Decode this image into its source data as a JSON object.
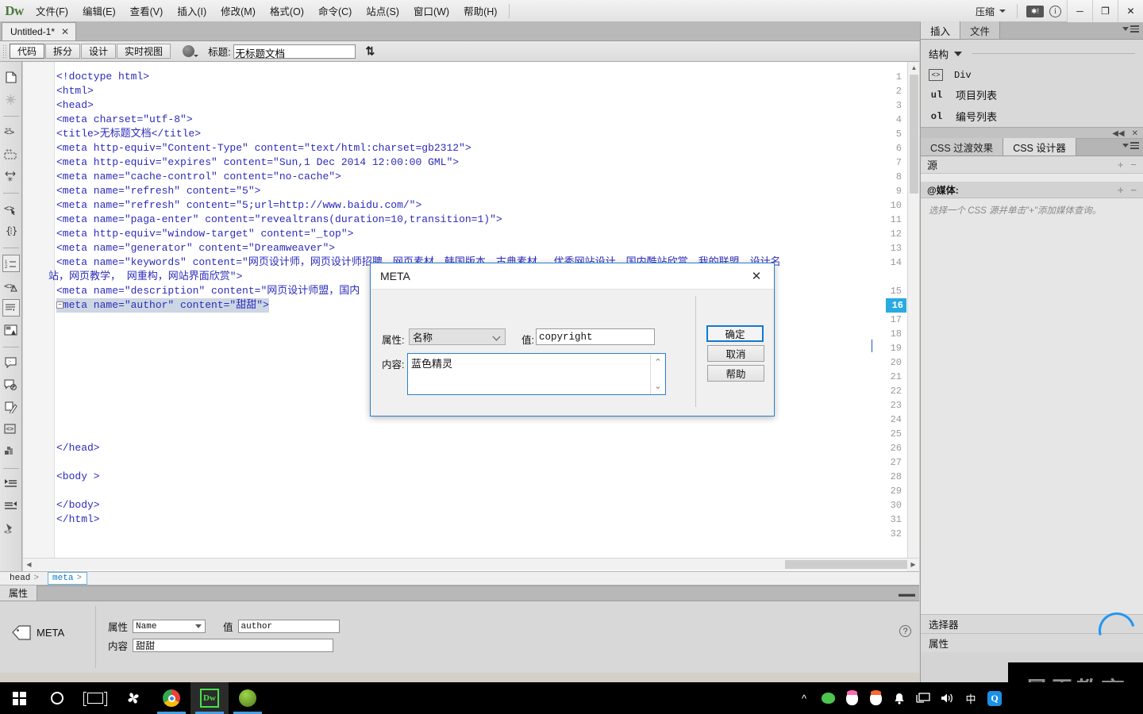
{
  "app": {
    "logo": "Dw",
    "menus": [
      "文件(F)",
      "编辑(E)",
      "查看(V)",
      "插入(I)",
      "修改(M)",
      "格式(O)",
      "命令(C)",
      "站点(S)",
      "窗口(W)",
      "帮助(H)"
    ],
    "workspace_label": "压缩",
    "badge": "✱!",
    "info": "i",
    "window_buttons": {
      "minimize": "─",
      "maximize": "❐",
      "close": "✕"
    }
  },
  "doc_tab": {
    "name": "Untitled-1*",
    "close": "✕"
  },
  "viewbar": {
    "buttons": [
      "代码",
      "拆分",
      "设计",
      "实时视图"
    ],
    "active_button": "代码",
    "title_label": "标题:",
    "title_value": "无标题文档",
    "swap_icon": "⇅"
  },
  "left_toolbar": {
    "icons": [
      "open-documents-icon",
      "highlight-invalid-icon",
      "apply-comment-icon",
      "remove-comment-icon",
      "wrap-tag-icon",
      "select-parent-tag-icon",
      "balance-braces-icon",
      "line-numbers-icon",
      "highlight-invalid-code-icon",
      "word-wrap-icon",
      "syntax-color-icon",
      "recent-snippets-icon",
      "collapse-selection-icon",
      "expand-all-icon",
      "format-source-icon",
      "indent-code-icon",
      "outdent-code-icon",
      "outdent-line-icon",
      "apply-source-format-icon"
    ]
  },
  "code": {
    "lines": [
      {
        "n": 1,
        "text": "<!doctype html>"
      },
      {
        "n": 2,
        "text": "<html>"
      },
      {
        "n": 3,
        "text": "<head>"
      },
      {
        "n": 4,
        "text": "<meta charset=\"utf-8\">"
      },
      {
        "n": 5,
        "text": "<title>无标题文档</title>"
      },
      {
        "n": 6,
        "text": "<meta http-equiv=\"Content-Type\" content=\"text/html:charset=gb2312\">"
      },
      {
        "n": 7,
        "text": "<meta http-equiv=\"expires\" content=\"Sun,1 Dec 2014 12:00:00 GML\">"
      },
      {
        "n": 8,
        "text": "<meta name=\"cache-control\" content=\"no-cache\">"
      },
      {
        "n": 9,
        "text": "<meta name=\"refresh\" content=\"5\">"
      },
      {
        "n": 10,
        "text": "<meta name=\"refresh\" content=\"5;url=http://www.baidu.com/\">"
      },
      {
        "n": 11,
        "text": "<meta name=\"paga-enter\" content=\"revealtrans(duration=10,transition=1)\">"
      },
      {
        "n": 12,
        "text": "<meta http-equiv=\"window-target\" content=\"_top\">"
      },
      {
        "n": 13,
        "text": "<meta name=\"generator\" content=\"Dreamweaver\">"
      },
      {
        "n": 14,
        "text": "<meta name=\"keywords\" content=\"网页设计师，网页设计师招聘，网页素材，韩国版本，古典素材， 优秀网站设计，国内酷站欣赏，我的联盟，设计名"
      },
      {
        "n": 14,
        "text": "站，网页教学， 网重构，网站界面欣赏\">",
        "wrapped": true
      },
      {
        "n": 15,
        "text": "<meta name=\"description\" content=\"网页设计师盟，国内"
      },
      {
        "n": 16,
        "text": "<meta name=\"author\" content=\"甜甜\">",
        "selected": true,
        "foldable": true
      },
      {
        "n": 17,
        "text": ""
      },
      {
        "n": 18,
        "text": ""
      },
      {
        "n": 19,
        "text": ""
      },
      {
        "n": 20,
        "text": ""
      },
      {
        "n": 21,
        "text": ""
      },
      {
        "n": 22,
        "text": ""
      },
      {
        "n": 23,
        "text": ""
      },
      {
        "n": 24,
        "text": ""
      },
      {
        "n": 25,
        "text": ""
      },
      {
        "n": 26,
        "text": "</head>"
      },
      {
        "n": 27,
        "text": ""
      },
      {
        "n": 28,
        "text": "<body >"
      },
      {
        "n": 29,
        "text": ""
      },
      {
        "n": 30,
        "text": "</body>"
      },
      {
        "n": 31,
        "text": "</html>"
      },
      {
        "n": 32,
        "text": ""
      }
    ]
  },
  "tag_selector": {
    "tags": [
      "head",
      "meta"
    ],
    "active": "meta"
  },
  "properties": {
    "tab_label": "属性",
    "element": "META",
    "attribute_label": "属性",
    "attribute_value": "Name",
    "value_label": "值",
    "value_value": "author",
    "content_label": "内容",
    "content_value": "甜甜",
    "help": "?"
  },
  "right_dock": {
    "top_tabs": [
      "插入",
      "文件"
    ],
    "top_active": "插入",
    "structure_label": "结构",
    "insert_items": [
      {
        "icon": "<>",
        "label": "Div",
        "mono": true
      },
      {
        "icon": "ul",
        "label": "项目列表",
        "mono": false
      },
      {
        "icon": "ol",
        "label": "编号列表",
        "mono": false
      }
    ],
    "collapse_icons": [
      "◀◀",
      "✕"
    ],
    "css_tabs": [
      "CSS 过渡效果",
      "CSS 设计器"
    ],
    "css_active": "CSS 设计器",
    "source_label": "源",
    "source_buttons": [
      "+",
      "−"
    ],
    "media_label": "@媒体:",
    "media_buttons": [
      "+",
      "−"
    ],
    "media_hint": "选择一个 CSS 源并单击\"+\"添加媒体查询。",
    "selector_label": "选择器",
    "property_label": "属性"
  },
  "dialog": {
    "title": "META",
    "close": "✕",
    "attribute_label": "属性:",
    "attribute_value": "名称",
    "value_label": "值:",
    "value_value": "copyright",
    "content_label": "内容:",
    "content_value": "蓝色精灵",
    "scroll_up": "⌃",
    "scroll_down": "⌄",
    "buttons": [
      {
        "label": "确定",
        "primary": true
      },
      {
        "label": "取消",
        "primary": false
      },
      {
        "label": "帮助",
        "primary": false
      }
    ]
  },
  "watermark": {
    "text": "最需教育"
  },
  "taskbar": {
    "items": [
      {
        "name": "start-button",
        "glyph": "windows"
      },
      {
        "name": "cortana-search",
        "glyph": "circle"
      },
      {
        "name": "task-view",
        "glyph": "taskview"
      },
      {
        "name": "pinwheel-app",
        "glyph": "pinwheel"
      },
      {
        "name": "chrome",
        "glyph": "chrome",
        "running": true
      },
      {
        "name": "dreamweaver",
        "glyph": "dw",
        "running": true,
        "active": true
      },
      {
        "name": "leaf-app",
        "glyph": "leaf",
        "running": true
      }
    ],
    "tray": [
      "^",
      "wechat",
      "qq-pink",
      "qq-orange",
      "bell",
      "monitor",
      "volume",
      "中",
      "Q"
    ]
  },
  "colors": {
    "accent": "#2c7fd0",
    "current_line": "#29abe2",
    "code_text": "#2b2bbb",
    "selection": "#cdd6e3",
    "chrome_bg": "#d4d0c8"
  }
}
